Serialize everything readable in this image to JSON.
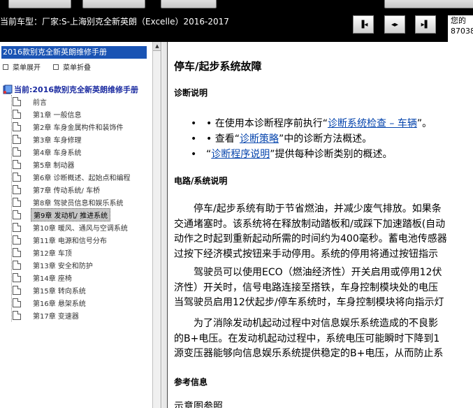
{
  "toolbar": {
    "car_model": "当前车型：厂家:S-上海别克全新英朗（Excelle）2016-2017",
    "user_info_line1": "您的",
    "user_info_line2": "87038"
  },
  "sidebar": {
    "manual_title": "2016款别克全新英朗维修手册",
    "expand_label": "菜单展开",
    "collapse_label": "菜单折叠",
    "root_label": "当前:2016款别克全新英朗维修手册",
    "chapters": [
      {
        "label": "前言"
      },
      {
        "label": "第1章  一般信息"
      },
      {
        "label": "第2章  车身金属构件和装饰件"
      },
      {
        "label": "第3章  车身修理"
      },
      {
        "label": "第4章  车身系统"
      },
      {
        "label": "第5章  制动器"
      },
      {
        "label": "第6章  诊断概述、起始点和编程"
      },
      {
        "label": "第7章  传动系统/ 车桥"
      },
      {
        "label": "第8章  驾驶员信息和娱乐系统"
      },
      {
        "label": "第9章  发动机/ 推进系统"
      },
      {
        "label": "第10章  暖风、通风与空调系统"
      },
      {
        "label": "第11章  电源和信号分布"
      },
      {
        "label": "第12章  车顶"
      },
      {
        "label": "第13章  安全和防护"
      },
      {
        "label": "第14章  座椅"
      },
      {
        "label": "第15章  转向系统"
      },
      {
        "label": "第16章  悬架系统"
      },
      {
        "label": "第17章  变速器"
      }
    ],
    "selected_index": 9
  },
  "content": {
    "title": "停车/起步系统故障",
    "diag_heading": "诊断说明",
    "bullets": [
      {
        "prefix": "• 在使用本诊断程序前执行“",
        "link": "诊断系统检查 – 车辆",
        "suffix": "”。"
      },
      {
        "prefix": "• 查看“",
        "link": "诊断策略",
        "suffix": "”中的诊断方法概述。"
      },
      {
        "prefix": "“",
        "link": "诊断程序说明",
        "suffix": "”提供每种诊断类别的概述。"
      }
    ],
    "circuit_heading": "电路/系统说明",
    "para1": [
      "　　停车/起步系统有助于节省燃油，并减少废气排放。如果条",
      "交通堵塞时。该系统将在释放制动踏板和/或踩下加速踏板(自动",
      "动作之时起到重新起动所需的时间约为400毫秒。蓄电池传感器",
      "过按下经济模式按钮来手动停用。系统的停用将通过按钮指示"
    ],
    "para2": [
      "　　驾驶员可以使用ECO（燃油经济性）开关启用或停用12伏",
      "济性）开关时，信号电路连接至搭铁，车身控制模块处的电压",
      "当驾驶员启用12伏起步/停车系统时，车身控制模块将向指示灯"
    ],
    "para3": [
      "　　为了消除发动机起动过程中对信息娱乐系统造成的不良影",
      "的B+电压。在发动机起动过程中，系统电压可能瞬时下降到1",
      "源变压器能够向信息娱乐系统提供稳定的B+电压，从而防止系"
    ],
    "ref_heading": "参考信息",
    "ref_line": "示意图参照"
  }
}
